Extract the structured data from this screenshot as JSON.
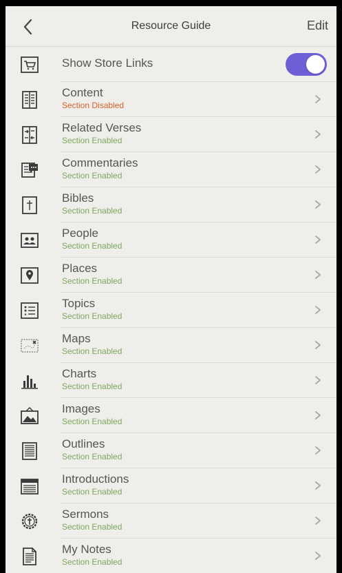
{
  "header": {
    "title": "Resource Guide",
    "edit_label": "Edit"
  },
  "store_links": {
    "label": "Show Store Links",
    "enabled": true
  },
  "sections": [
    {
      "label": "Content",
      "status": "Section Disabled",
      "state": "disabled",
      "icon": "content-icon"
    },
    {
      "label": "Related Verses",
      "status": "Section Enabled",
      "state": "enabled",
      "icon": "related-verses-icon"
    },
    {
      "label": "Commentaries",
      "status": "Section Enabled",
      "state": "enabled",
      "icon": "commentaries-icon"
    },
    {
      "label": "Bibles",
      "status": "Section Enabled",
      "state": "enabled",
      "icon": "bible-icon"
    },
    {
      "label": "People",
      "status": "Section Enabled",
      "state": "enabled",
      "icon": "people-icon"
    },
    {
      "label": "Places",
      "status": "Section Enabled",
      "state": "enabled",
      "icon": "places-icon"
    },
    {
      "label": "Topics",
      "status": "Section Enabled",
      "state": "enabled",
      "icon": "topics-icon"
    },
    {
      "label": "Maps",
      "status": "Section Enabled",
      "state": "enabled",
      "icon": "maps-icon"
    },
    {
      "label": "Charts",
      "status": "Section Enabled",
      "state": "enabled",
      "icon": "charts-icon"
    },
    {
      "label": "Images",
      "status": "Section Enabled",
      "state": "enabled",
      "icon": "images-icon"
    },
    {
      "label": "Outlines",
      "status": "Section Enabled",
      "state": "enabled",
      "icon": "outlines-icon"
    },
    {
      "label": "Introductions",
      "status": "Section Enabled",
      "state": "enabled",
      "icon": "introductions-icon"
    },
    {
      "label": "Sermons",
      "status": "Section Enabled",
      "state": "enabled",
      "icon": "sermons-icon"
    },
    {
      "label": "My Notes",
      "status": "Section Enabled",
      "state": "enabled",
      "icon": "notes-icon"
    }
  ],
  "colors": {
    "background": "#efeeea",
    "toggle_on": "#6e5fd6",
    "status_enabled": "#7ba85f",
    "status_disabled": "#d5602a"
  }
}
